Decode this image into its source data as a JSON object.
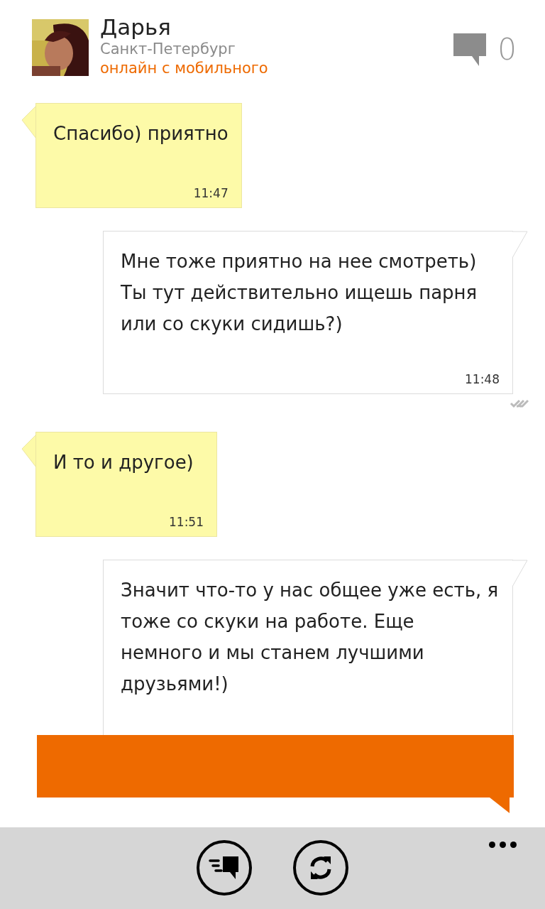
{
  "contact": {
    "name": "Дарья",
    "city": "Санкт-Петербург",
    "status": "онлайн с мобильного"
  },
  "comments": {
    "count": "0"
  },
  "messages": [
    {
      "kind": "incoming",
      "text": "Спасибо) приятно",
      "time": "11:47"
    },
    {
      "kind": "outgoing",
      "text": "Мне тоже приятно на нее смотреть) Ты тут действительно ищешь парня или со скуки сидишь?)",
      "time": "11:48",
      "read": true
    },
    {
      "kind": "incoming",
      "text": "И то и другое)",
      "time": "11:51"
    },
    {
      "kind": "outgoing",
      "text": "Значит что-то у нас общее уже есть, я тоже со скуки на работе. Еще немного и мы станем лучшими друзьями!)"
    }
  ],
  "app_bar": {
    "buttons": [
      {
        "kind": "send"
      },
      {
        "kind": "refresh"
      }
    ]
  }
}
